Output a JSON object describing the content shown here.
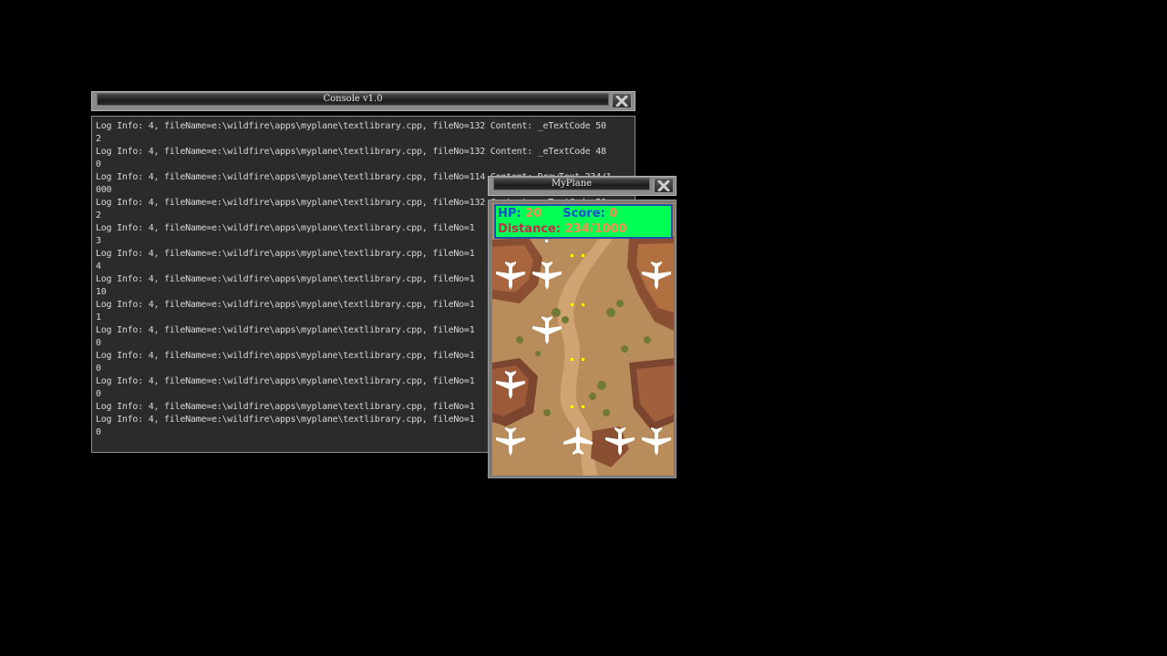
{
  "console": {
    "title": "Console v1.0",
    "lines": [
      "Log Info: 4, fileName=e:\\wildfire\\apps\\myplane\\textlibrary.cpp, fileNo=132 Content: _eTextCode 50\n2",
      "Log Info: 4, fileName=e:\\wildfire\\apps\\myplane\\textlibrary.cpp, fileNo=132 Content: _eTextCode 48\n0",
      "Log Info: 4, fileName=e:\\wildfire\\apps\\myplane\\textlibrary.cpp, fileNo=114 Content: DrawText 234/1\n000",
      "Log Info: 4, fileName=e:\\wildfire\\apps\\myplane\\textlibrary.cpp, fileNo=132 Content: _eTextCode 50\n2",
      "Log Info: 4, fileName=e:\\wildfire\\apps\\myplane\\textlibrary.cpp, fileNo=1\n3",
      "Log Info: 4, fileName=e:\\wildfire\\apps\\myplane\\textlibrary.cpp, fileNo=1\n4",
      "Log Info: 4, fileName=e:\\wildfire\\apps\\myplane\\textlibrary.cpp, fileNo=1\n10",
      "Log Info: 4, fileName=e:\\wildfire\\apps\\myplane\\textlibrary.cpp, fileNo=1\n1",
      "Log Info: 4, fileName=e:\\wildfire\\apps\\myplane\\textlibrary.cpp, fileNo=1\n0",
      "Log Info: 4, fileName=e:\\wildfire\\apps\\myplane\\textlibrary.cpp, fileNo=1\n0",
      "Log Info: 4, fileName=e:\\wildfire\\apps\\myplane\\textlibrary.cpp, fileNo=1\n0",
      "Log Info: 4, fileName=e:\\wildfire\\apps\\myplane\\textlibrary.cpp, fileNo=1",
      "Log Info: 4, fileName=e:\\wildfire\\apps\\myplane\\textlibrary.cpp, fileNo=1\n0"
    ]
  },
  "game": {
    "title": "MyPlane",
    "hud": {
      "hp_label": "HP:",
      "hp_value": "20",
      "score_label": "Score:",
      "score_value": "0",
      "distance_label": "Distance:",
      "distance_value": "234/1000"
    },
    "colors": {
      "hud_bg": "#00ff55",
      "hud_border": "#1f4fb0",
      "label_blue": "#1a4fd0",
      "label_red": "#c8284a",
      "value_orange": "#ff8a50",
      "bullet": "#ffff00",
      "ground": "#b88a5a"
    }
  }
}
